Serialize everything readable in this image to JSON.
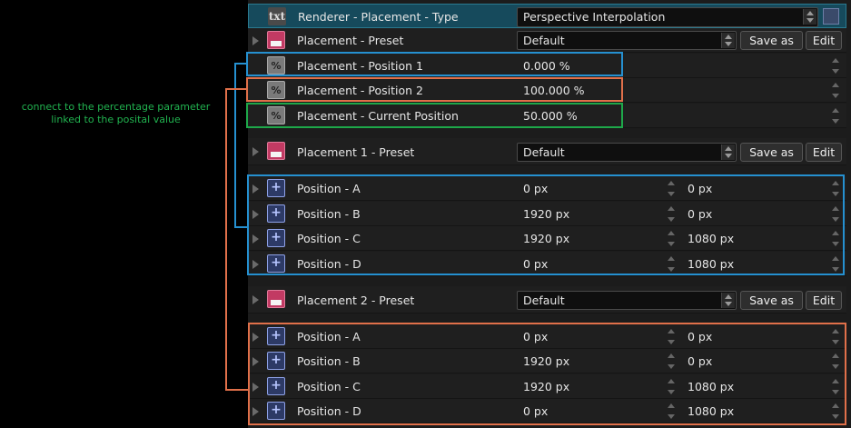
{
  "annotation": {
    "line1": "connect to the percentage parameter",
    "line2": "linked to the posital value"
  },
  "renderer": {
    "icon": "txt",
    "label": "Renderer - Placement - Type",
    "value": "Perspective Interpolation"
  },
  "placement": {
    "preset_label": "Placement - Preset",
    "preset_value": "Default",
    "save_as": "Save as",
    "edit": "Edit",
    "pos1_label": "Placement - Position 1",
    "pos1_value": "0.000 %",
    "pos2_label": "Placement - Position 2",
    "pos2_value": "100.000 %",
    "current_label": "Placement - Current Position",
    "current_value": "50.000 %",
    "percent_icon": "%"
  },
  "placement1": {
    "preset_label": "Placement 1 - Preset",
    "preset_value": "Default",
    "save_as": "Save as",
    "edit": "Edit",
    "positions": [
      {
        "label": "Position - A",
        "x": "0 px",
        "y": "0 px"
      },
      {
        "label": "Position - B",
        "x": "1920 px",
        "y": "0 px"
      },
      {
        "label": "Position - C",
        "x": "1920 px",
        "y": "1080 px"
      },
      {
        "label": "Position - D",
        "x": "0 px",
        "y": "1080 px"
      }
    ]
  },
  "placement2": {
    "preset_label": "Placement 2 - Preset",
    "preset_value": "Default",
    "save_as": "Save as",
    "edit": "Edit",
    "positions": [
      {
        "label": "Position - A",
        "x": "0 px",
        "y": "0 px"
      },
      {
        "label": "Position - B",
        "x": "1920 px",
        "y": "0 px"
      },
      {
        "label": "Position - C",
        "x": "1920 px",
        "y": "1080 px"
      },
      {
        "label": "Position - D",
        "x": "0 px",
        "y": "1080 px"
      }
    ]
  },
  "colors": {
    "annotation_green": "#21b24f",
    "frame_blue": "#2590d0",
    "frame_orange": "#e0704a",
    "frame_green": "#1ea84a",
    "header_bg": "#164a5c"
  },
  "icons": {
    "expand": "expand-arrow-icon",
    "text": "text-type-icon",
    "save": "save-disk-icon",
    "percent": "percent-icon",
    "position": "position-crosshair-icon"
  }
}
